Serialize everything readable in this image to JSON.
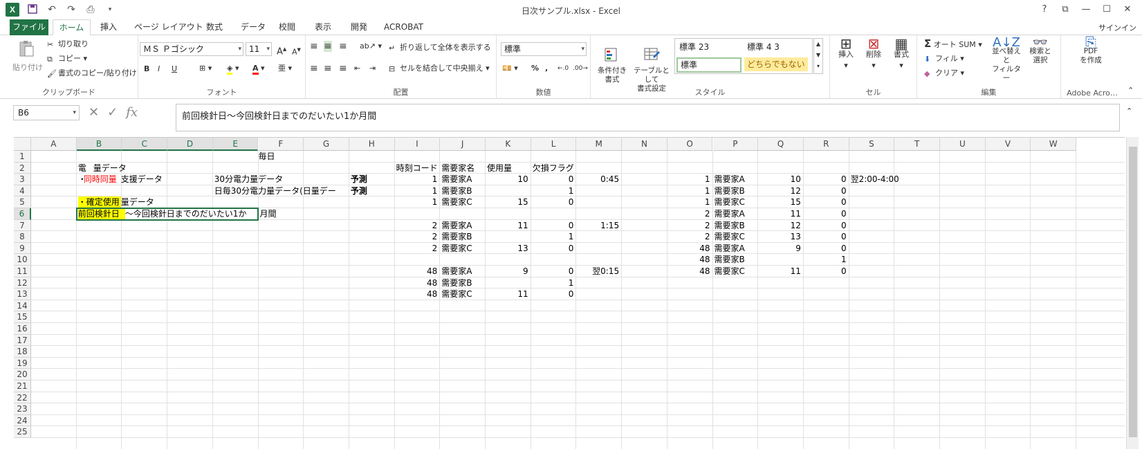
{
  "window": {
    "title": "日次サンプル.xlsx - Excel",
    "logo": "X",
    "controls": [
      "?",
      "⧉",
      "—",
      "☐",
      "✕"
    ],
    "user": "サインイン"
  },
  "tabs": [
    "ファイル",
    "ホーム",
    "挿入",
    "ページ レイアウト",
    "数式",
    "データ",
    "校閲",
    "表示",
    "開発",
    "ACROBAT"
  ],
  "ribbon": {
    "clipboard": {
      "paste": "貼り付け",
      "cut": "切り取り",
      "copy": "コピー",
      "format_painter": "書式のコピー/貼り付け",
      "label": "クリップボード"
    },
    "font": {
      "name": "ＭＳ Ｐゴシック",
      "size": "11",
      "label": "フォント",
      "bold": "B",
      "italic": "I",
      "underline": "U"
    },
    "alignment": {
      "wrap": "折り返して全体を表示する",
      "merge": "セルを結合して中央揃え",
      "label": "配置"
    },
    "number": {
      "format": "標準",
      "percent": "%",
      "comma": ",",
      "label": "数値"
    },
    "styles": {
      "conditional": "条件付き\n書式",
      "table": "テーブルとして\n書式設定",
      "items": [
        "標準 23",
        "標準 4 3",
        "標準",
        "どちらでもない"
      ],
      "label": "スタイル"
    },
    "cells": {
      "insert": "挿入",
      "delete": "削除",
      "format": "書式",
      "label": "セル"
    },
    "editing": {
      "autosum": "オート SUM",
      "fill": "フィル",
      "clear": "クリア",
      "sort": "並べ替えと\nフィルター",
      "find": "検索と\n選択",
      "label": "編集"
    },
    "adobe": {
      "pdf": "PDF\nを作成",
      "label": "Adobe Acro…"
    }
  },
  "formula_bar": {
    "name_box": "B6",
    "content": "前回検針日～今回検針日までのだいたい1か月間"
  },
  "columns": [
    "A",
    "B",
    "C",
    "D",
    "E",
    "F",
    "G",
    "H",
    "I",
    "J",
    "K",
    "L",
    "M",
    "N",
    "O",
    "P",
    "Q",
    "R",
    "S",
    "T",
    "U",
    "V",
    "W"
  ],
  "rows": [
    "1",
    "2",
    "3",
    "4",
    "5",
    "6",
    "7",
    "8",
    "9",
    "10",
    "11",
    "12",
    "13",
    "14",
    "15",
    "16",
    "17",
    "18",
    "19",
    "20",
    "21",
    "22",
    "23",
    "24",
    "25"
  ],
  "cells": {
    "F1": "毎日",
    "B2": "電",
    "B2b": "量データ",
    "B3a": "・",
    "B3b": "同時同量",
    "B3c": "支援データ",
    "E3": "30分電力量データ",
    "E4": "日毎30分電力量データ(日量デー",
    "H3": "予測",
    "H4": "予測",
    "B5a": "・確定使用",
    "B5b": "量データ",
    "B6a": "前回検針日",
    "B6b": "～今回検針日までのだいたい1か",
    "F6": "月間",
    "I2": "時刻コード",
    "J2": "需要家名",
    "K2": "使用量",
    "L2": "欠損フラグ",
    "I3": "1",
    "J3": "需要家A",
    "K3": "10",
    "L3": "0",
    "M3": "0:45",
    "I4": "1",
    "J4": "需要家B",
    "L4": "1",
    "I5": "1",
    "J5": "需要家C",
    "K5": "15",
    "L5": "0",
    "I7": "2",
    "J7": "需要家A",
    "K7": "11",
    "L7": "0",
    "M7": "1:15",
    "I8": "2",
    "J8": "需要家B",
    "L8": "1",
    "I9": "2",
    "J9": "需要家C",
    "K9": "13",
    "L9": "0",
    "I11": "48",
    "J11": "需要家A",
    "K11": "9",
    "L11": "0",
    "M11": "翌0:15",
    "I12": "48",
    "J12": "需要家B",
    "L12": "1",
    "I13": "48",
    "J13": "需要家C",
    "K13": "11",
    "L13": "0",
    "O3": "1",
    "P3": "需要家A",
    "Q3": "10",
    "R3": "0",
    "S3": "翌2:00-4:00",
    "O4": "1",
    "P4": "需要家B",
    "Q4": "12",
    "R4": "0",
    "O5": "1",
    "P5": "需要家C",
    "Q5": "15",
    "R5": "0",
    "O6": "2",
    "P6": "需要家A",
    "Q6": "11",
    "R6": "0",
    "O7": "2",
    "P7": "需要家B",
    "Q7": "12",
    "R7": "0",
    "O8": "2",
    "P8": "需要家C",
    "Q8": "13",
    "R8": "0",
    "O9": "48",
    "P9": "需要家A",
    "Q9": "9",
    "R9": "0",
    "O10": "48",
    "P10": "需要家B",
    "R10": "1",
    "O11": "48",
    "P11": "需要家C",
    "Q11": "11",
    "R11": "0"
  }
}
